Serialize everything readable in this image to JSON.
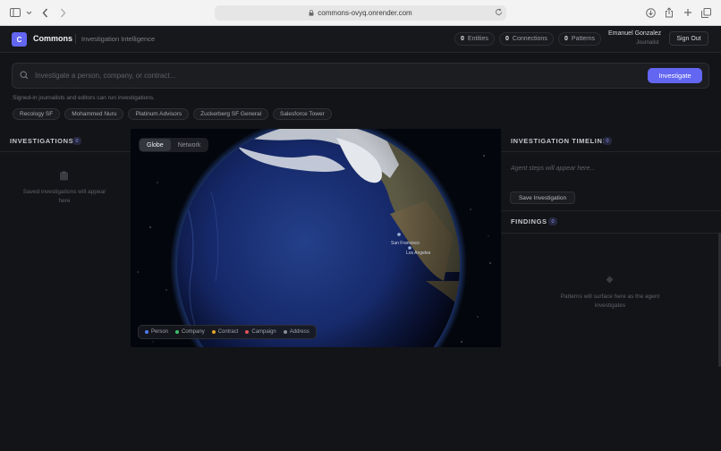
{
  "browser": {
    "url": "commons-ovyq.onrender.com",
    "icons": [
      "sidebar-icon",
      "chevron-down-icon",
      "back-icon",
      "forward-icon",
      "lock-icon",
      "reload-icon",
      "download-icon",
      "share-icon",
      "new-tab-icon",
      "tabs-icon"
    ]
  },
  "header": {
    "logo_letter": "C",
    "brand": "Commons",
    "subtitle": "Investigation Intelligence",
    "stats": [
      {
        "count": "0",
        "label": "Entities"
      },
      {
        "count": "0",
        "label": "Connections"
      },
      {
        "count": "0",
        "label": "Patterns"
      }
    ],
    "user_name": "Emanuel Gonzalez",
    "user_role": "Journalist",
    "signout_label": "Sign Out"
  },
  "search": {
    "placeholder": "Investigate a person, company, or contract...",
    "button_label": "Investigate",
    "hint": "Signed-in journalists and editors can run investigations.",
    "suggestions": [
      "Recology SF",
      "Mohammed Nuru",
      "Platinum Advisors",
      "Zuckerberg SF General",
      "Salesforce Tower"
    ]
  },
  "investigations": {
    "title": "INVESTIGATIONS",
    "count": "0",
    "empty_text": "Saved investigations will appear here"
  },
  "map": {
    "tabs": [
      {
        "label": "Globe",
        "active": true
      },
      {
        "label": "Network",
        "active": false
      }
    ],
    "city_labels": [
      "San Francisco",
      "Los Angeles"
    ],
    "legend": [
      {
        "label": "Person",
        "color": "#4f7cf7"
      },
      {
        "label": "Company",
        "color": "#3fbf6f"
      },
      {
        "label": "Contract",
        "color": "#e5a32b"
      },
      {
        "label": "Campaign",
        "color": "#e0525a"
      },
      {
        "label": "Address",
        "color": "#8a8d94"
      }
    ]
  },
  "timeline": {
    "title": "INVESTIGATION TIMELINE",
    "count": "0",
    "placeholder": "Agent steps will appear here...",
    "save_label": "Save Investigation"
  },
  "findings": {
    "title": "FINDINGS",
    "count": "0",
    "empty_text": "Patterns will surface here as the agent investigates"
  }
}
